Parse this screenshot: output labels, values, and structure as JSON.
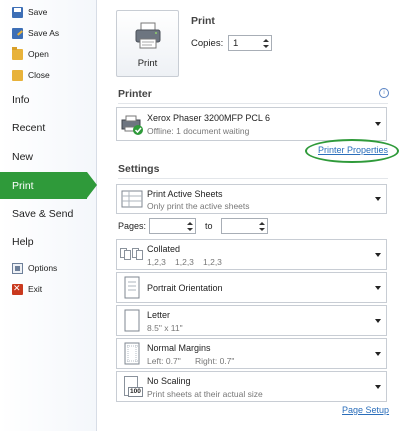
{
  "nav": {
    "save": "Save",
    "save_as": "Save As",
    "open": "Open",
    "close": "Close",
    "info": "Info",
    "recent": "Recent",
    "new": "New",
    "print": "Print",
    "save_send": "Save & Send",
    "help": "Help",
    "options": "Options",
    "exit": "Exit"
  },
  "print_section": {
    "title": "Print",
    "button_label": "Print",
    "copies_label": "Copies:",
    "copies_value": "1"
  },
  "printer": {
    "header": "Printer",
    "name": "Xerox Phaser 3200MFP PCL 6",
    "status": "Offline: 1 document waiting",
    "properties_link": "Printer Properties"
  },
  "settings": {
    "header": "Settings",
    "what_to_print": {
      "title": "Print Active Sheets",
      "subtitle": "Only print the active sheets"
    },
    "pages_label": "Pages:",
    "pages_to": "to",
    "collation": {
      "title": "Collated",
      "subtitle": [
        "1,2,3",
        "1,2,3",
        "1,2,3"
      ]
    },
    "orientation": {
      "title": "Portrait Orientation"
    },
    "paper": {
      "title": "Letter",
      "subtitle": "8.5\" x 11\""
    },
    "margins": {
      "title": "Normal Margins",
      "left": "Left: 0.7\"",
      "right": "Right: 0.7\""
    },
    "scaling": {
      "title": "No Scaling",
      "subtitle": "Print sheets at their actual size",
      "icon_label": "100"
    },
    "page_setup_link": "Page Setup"
  },
  "colors": {
    "accent": "#2f9a3a",
    "link": "#2a6ebb"
  }
}
